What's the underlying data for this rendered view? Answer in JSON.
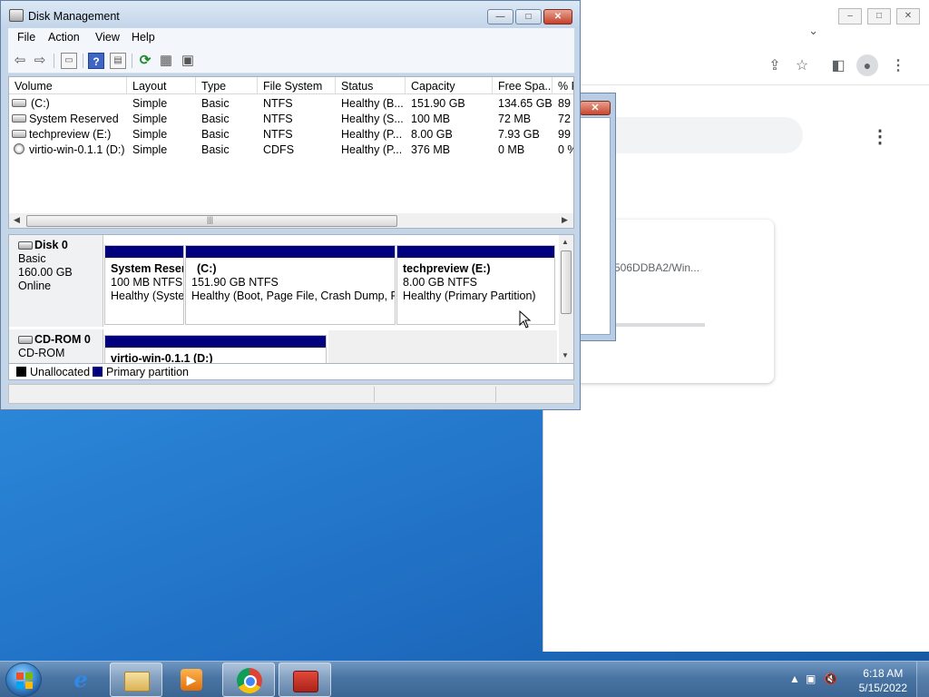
{
  "browser": {
    "card_text": "506DDBA2/Win...",
    "window_buttons": [
      "–",
      "□",
      "✕"
    ]
  },
  "dialog": {
    "close_glyph": "✕"
  },
  "disk_management": {
    "title": "Disk Management",
    "window_buttons": {
      "minimize": "—",
      "maximize": "□",
      "close": "✕"
    },
    "menu": [
      "File",
      "Action",
      "View",
      "Help"
    ],
    "columns": [
      "Volume",
      "Layout",
      "Type",
      "File System",
      "Status",
      "Capacity",
      "Free Spa...",
      "% F"
    ],
    "volumes": [
      {
        "icon": "disk-icon",
        "name": "(C:)",
        "layout": "Simple",
        "type": "Basic",
        "fs": "NTFS",
        "status": "Healthy (B...",
        "capacity": "151.90 GB",
        "free": "134.65 GB",
        "pct": "89"
      },
      {
        "icon": "disk-icon",
        "name": "System Reserved",
        "layout": "Simple",
        "type": "Basic",
        "fs": "NTFS",
        "status": "Healthy (S...",
        "capacity": "100 MB",
        "free": "72 MB",
        "pct": "72"
      },
      {
        "icon": "disk-icon",
        "name": "techpreview (E:)",
        "layout": "Simple",
        "type": "Basic",
        "fs": "NTFS",
        "status": "Healthy (P...",
        "capacity": "8.00 GB",
        "free": "7.93 GB",
        "pct": "99"
      },
      {
        "icon": "cd-icon",
        "name": "virtio-win-0.1.1 (D:)",
        "layout": "Simple",
        "type": "Basic",
        "fs": "CDFS",
        "status": "Healthy (P...",
        "capacity": "376 MB",
        "free": "0 MB",
        "pct": "0 %"
      }
    ],
    "disks": [
      {
        "name": "Disk 0",
        "type": "Basic",
        "size": "160.00 GB",
        "state": "Online",
        "partitions": [
          {
            "name": "System Reser",
            "size": "100 MB NTFS",
            "status": "Healthy (Syste"
          },
          {
            "name": "(C:)",
            "size": "151.90 GB NTFS",
            "status": "Healthy (Boot, Page File, Crash Dump, Pr"
          },
          {
            "name": "techpreview  (E:)",
            "size": "8.00 GB NTFS",
            "status": "Healthy (Primary Partition)"
          }
        ]
      },
      {
        "name": "CD-ROM 0",
        "type": "CD-ROM",
        "partitions": [
          {
            "name": "virtio-win-0.1.1  (D:)"
          }
        ]
      }
    ],
    "legend": [
      {
        "label": "Unallocated",
        "color": "#000000"
      },
      {
        "label": "Primary partition",
        "color": "#00007e"
      }
    ]
  },
  "taskbar": {
    "time": "6:18 AM",
    "date": "5/15/2022",
    "apps": [
      "internet-explorer",
      "windows-explorer",
      "media-player",
      "chrome",
      "disk-management"
    ]
  }
}
